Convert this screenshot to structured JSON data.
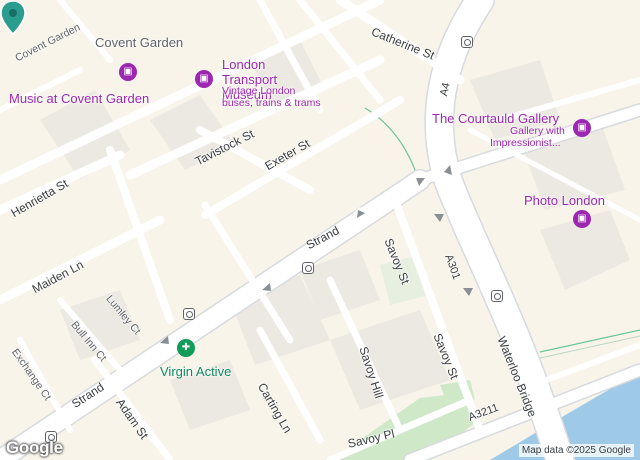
{
  "map": {
    "attribution": "Map data ©2025 Google",
    "logo": "Google",
    "streets": {
      "strand_center": "Strand",
      "strand_west": "Strand",
      "catherine": "Catherine St",
      "tavistock": "Tavistock St",
      "exeter": "Exeter St",
      "henrietta": "Henrietta St",
      "maiden": "Maiden Ln",
      "lumley": "Lumley Ct",
      "bull_inn": "Bull Inn Ct",
      "exchange": "Exchange Ct",
      "adam": "Adam St",
      "carting": "Carting Ln",
      "savoy_hill": "Savoy Hill",
      "savoy_st_upper": "Savoy St",
      "savoy_st_lower": "Savoy St",
      "savoy_pl": "Savoy Pl",
      "waterloo": "Waterloo Bridge",
      "covent_garden_small": "Covent Garden"
    },
    "road_numbers": {
      "a4": "A4",
      "a301": "A301",
      "a3211": "A3211"
    },
    "places": {
      "covent_garden": "Covent Garden",
      "music": "Music at Covent Garden",
      "transport_museum": "London Transport Museum",
      "transport_museum_sub1": "Vintage London",
      "transport_museum_sub2": "buses, trains & trams",
      "courtauld": "The Courtauld Gallery",
      "courtauld_sub1": "Gallery with",
      "courtauld_sub2": "Impressionist...",
      "photo_london": "Photo London",
      "virgin_active": "Virgin Active"
    },
    "icons": {
      "music": "museum-icon",
      "transport_museum": "museum-icon",
      "courtauld": "museum-icon",
      "photo_london": "museum-icon",
      "virgin_active": "fitness-icon",
      "pin": "location-pin-icon",
      "transit": "subway-station-icon"
    },
    "colors": {
      "land": "#f8f4ea",
      "road": "#ffffff",
      "block": "#ece8df",
      "water": "#9ecae8",
      "park": "#cfe9c8",
      "pin": "#2a9d8f",
      "poi": "#9c27b0"
    }
  }
}
